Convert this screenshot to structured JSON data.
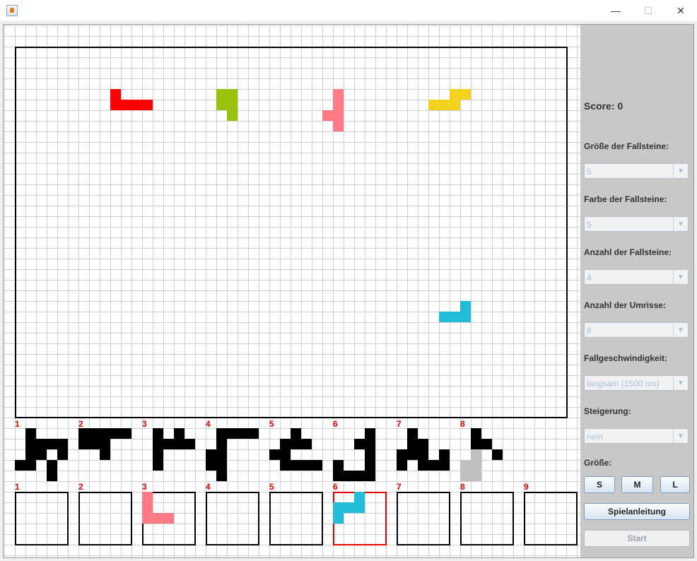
{
  "window": {
    "minimize_glyph": "—",
    "maximize_glyph": "☐",
    "close_glyph": "✕"
  },
  "icons": {
    "app": "java-app-icon"
  },
  "colors": {
    "red": "#ff0000",
    "green": "#99c20f",
    "pink": "#ff7a85",
    "yellow": "#f2d21f",
    "cyan": "#22bcd9",
    "black": "#000000",
    "gray": "#c0c0c0",
    "highlight": "#e00000"
  },
  "outline_numbers": [
    "1",
    "2",
    "3",
    "4",
    "5",
    "6",
    "7",
    "8"
  ],
  "slot_numbers": [
    "1",
    "2",
    "3",
    "4",
    "5",
    "6",
    "7",
    "8",
    "9"
  ],
  "sidebar": {
    "score": "Score: 0",
    "size_label": "Größe der Fallsteine:",
    "size_value": "5",
    "color_label": "Farbe der Fallsteine:",
    "color_value": "5",
    "count_label": "Anzahl der Fallsteine:",
    "count_value": "4",
    "outline_label": "Anzahl der Umrisse:",
    "outline_value": "8",
    "speed_label": "Fallgeschwindigkeit:",
    "speed_value": "langsam (1500 ms)",
    "increase_label": "Steigerung:",
    "increase_value": "nein",
    "grid_size_label": "Größe:",
    "btn_s": "S",
    "btn_m": "M",
    "btn_l": "L",
    "manual": "Spielanleitung",
    "start": "Start"
  }
}
